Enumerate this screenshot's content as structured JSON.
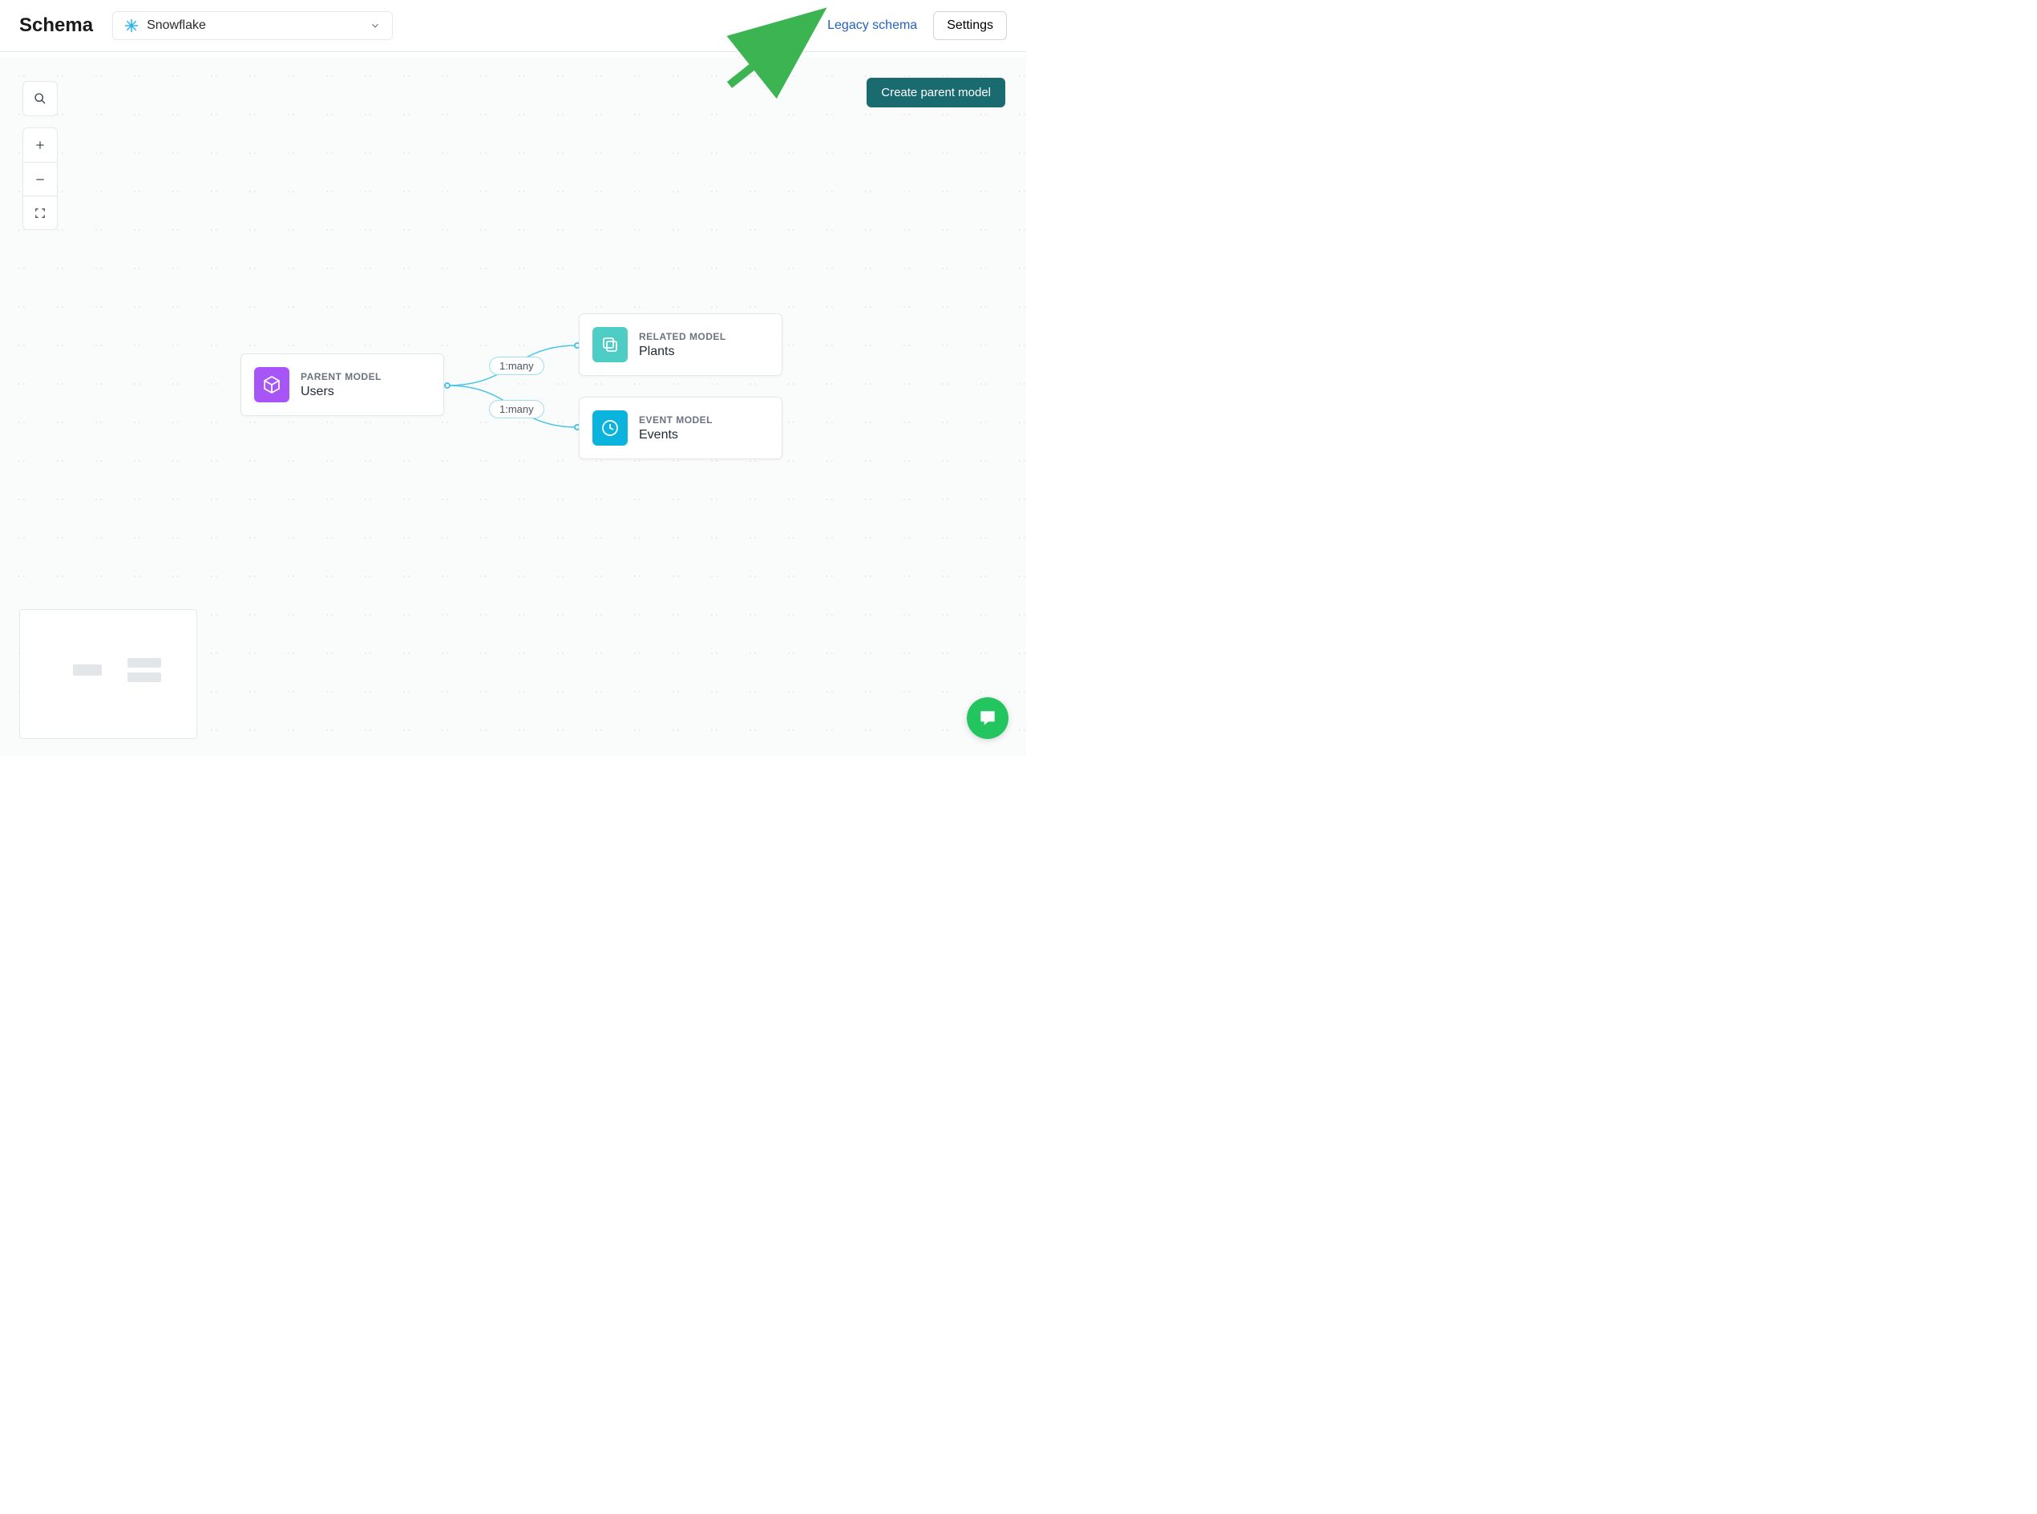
{
  "header": {
    "title": "Schema",
    "source": "Snowflake",
    "legacy_link": "Legacy schema",
    "settings_label": "Settings"
  },
  "actions": {
    "create_parent_model": "Create parent model"
  },
  "nodes": {
    "parent": {
      "type": "PARENT MODEL",
      "name": "Users"
    },
    "related": {
      "type": "RELATED MODEL",
      "name": "Plants"
    },
    "event": {
      "type": "EVENT MODEL",
      "name": "Events"
    }
  },
  "edges": {
    "to_related": "1:many",
    "to_event": "1:many"
  },
  "icon_names": {
    "source": "snowflake-icon",
    "search": "search-icon",
    "zoom_in": "plus-icon",
    "zoom_out": "minus-icon",
    "fit": "expand-icon",
    "parent": "cube-icon",
    "related": "stack-icon",
    "event": "clock-icon",
    "chat": "chat-icon"
  },
  "colors": {
    "accent_teal": "#1a6b70",
    "link_blue": "#2463bc",
    "edge": "#49c5e8",
    "purple": "#a855f7",
    "teal": "#4ecdc4",
    "cyan": "#0bb4dd",
    "chat_green": "#22c55e",
    "annotation_green": "#3db452"
  }
}
